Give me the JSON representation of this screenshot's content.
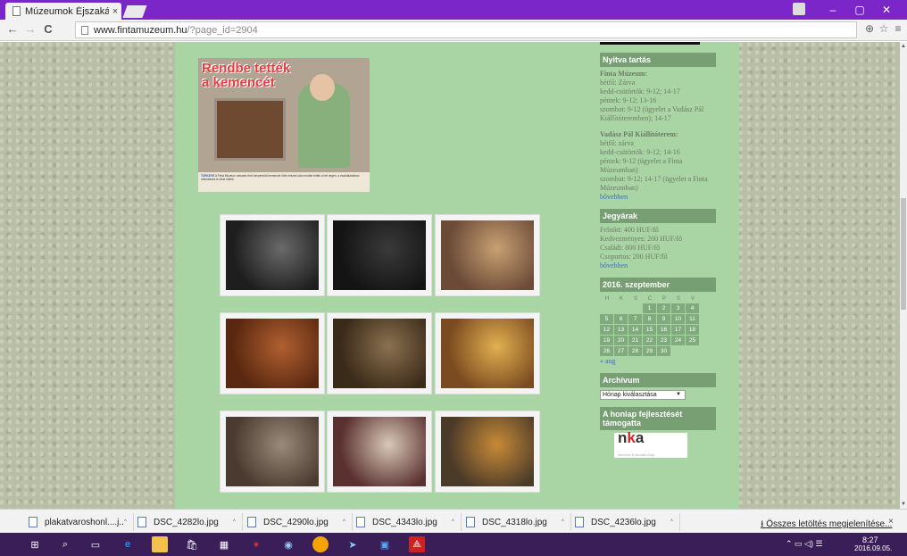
{
  "browser": {
    "tab_title": "Múzeumok Éjszakája",
    "tab_close": "×",
    "url_host": "www.fintamuzeum.hu",
    "url_path": "/?page_id=2904",
    "window_controls": [
      "–",
      "▢",
      "✕"
    ],
    "nav": {
      "back": "←",
      "forward": "→",
      "reload": "C"
    }
  },
  "hero": {
    "title_line1": "Rendbe tették",
    "title_line2": "a kemencét",
    "caption_label": "TÚRKEVE",
    "caption_text": "A Finta Múzeum udvarán lévő kenyérsütő kemencét több évtized után rendbe tették a hét végén, a munkálatokban önkéntesek is részt vettek."
  },
  "gallery": {
    "rows": [
      [
        {
          "name": "photo-dark-room",
          "color": "#1e1e1e",
          "accent": "#6a6a6a"
        },
        {
          "name": "photo-dark-night",
          "color": "#141414",
          "accent": "#3a3a3a"
        },
        {
          "name": "photo-crafts-table",
          "color": "#6b4a38",
          "accent": "#c7a071"
        }
      ],
      [
        {
          "name": "photo-audience",
          "color": "#5a2810",
          "accent": "#b06030"
        },
        {
          "name": "photo-courtyard",
          "color": "#3a2a18",
          "accent": "#8a7050"
        },
        {
          "name": "photo-colored-rings",
          "color": "#7a4a20",
          "accent": "#e0b050"
        }
      ],
      [
        {
          "name": "photo-exhibition",
          "color": "#4a3a30",
          "accent": "#9a8a7a"
        },
        {
          "name": "photo-reading",
          "color": "#5a3030",
          "accent": "#d8c8b8"
        },
        {
          "name": "photo-workshop",
          "color": "#4a3a28",
          "accent": "#c88a38"
        }
      ]
    ]
  },
  "sidebar": {
    "opening": {
      "heading": "Nyitva tartás",
      "finta_title": "Finta Múzeum:",
      "finta_lines": [
        "hétfő: Zárva",
        "kedd-csütörtök: 9-12; 14-17",
        "péntek: 9-12; 13-16",
        "szombat: 9-12 (ügyelet a Vadász Pál",
        "Kiállítóteremben); 14-17"
      ],
      "vadasz_title": "Vadász Pál Kiállítóterem:",
      "vadasz_lines": [
        "hétfő: zárva",
        "kedd-csütörtök: 9-12; 14-16",
        "péntek: 9-12 (ügyelet a Finta",
        "Múzeumban)",
        "szombat: 9-12; 14-17 (ügyelet a Finta",
        "Múzeumban)"
      ],
      "more": "bővebben"
    },
    "tickets": {
      "heading": "Jegyárak",
      "lines": [
        "Felnőtt: 400 HUF/fő",
        "Kedvezményes: 200 HUF/fő",
        "Családi: 800 HUF/fő",
        "Csoportos: 200 HUF/fő"
      ],
      "more": "bővebben"
    },
    "calendar": {
      "heading": "2016. szeptember",
      "weekdays": [
        "H",
        "K",
        "S",
        "C",
        "P",
        "S",
        "V"
      ],
      "weeks": [
        [
          "",
          "",
          "",
          "1",
          "2",
          "3",
          "4"
        ],
        [
          "5",
          "6",
          "7",
          "8",
          "9",
          "10",
          "11"
        ],
        [
          "12",
          "13",
          "14",
          "15",
          "16",
          "17",
          "18"
        ],
        [
          "19",
          "20",
          "21",
          "22",
          "23",
          "24",
          "25"
        ],
        [
          "26",
          "27",
          "28",
          "29",
          "30",
          "",
          ""
        ]
      ],
      "prev": "« aug"
    },
    "archive": {
      "heading": "Archívum",
      "select": "Hónap kiválasztása"
    },
    "support": {
      "heading": "A honlap fejlesztését támogatta",
      "logo_text": "nka",
      "logo_sub": "Nemzeti Kulturális Alap"
    }
  },
  "downloads": {
    "items": [
      "plakatvaroshonl....j...",
      "DSC_4282lo.jpg",
      "DSC_4290lo.jpg",
      "DSC_4343lo.jpg",
      "DSC_4318lo.jpg",
      "DSC_4236lo.jpg"
    ],
    "show_all": "Összes letöltés megjelenítése...",
    "close": "×"
  },
  "taskbar": {
    "time": "8:27",
    "date": "2016.09.05."
  }
}
